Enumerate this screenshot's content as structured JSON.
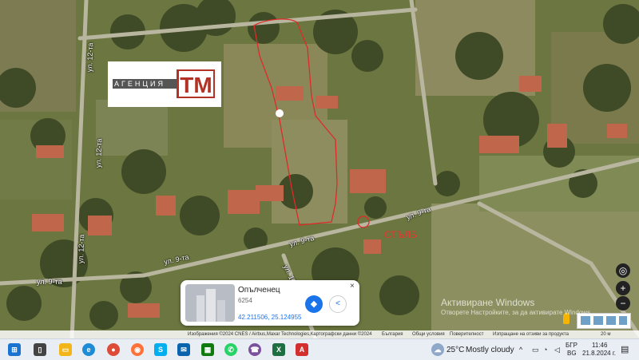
{
  "logo": {
    "agency_text": "АГЕНЦИЯ",
    "mark": "ТМ"
  },
  "map": {
    "roads": [
      {
        "label": "ул. 12-та"
      },
      {
        "label": "ул. 12-та"
      },
      {
        "label": "ул. 12-та"
      },
      {
        "label": "ул. 9-та"
      },
      {
        "label": "ул. 9-та"
      },
      {
        "label": "ул. 9-та"
      },
      {
        "label": "ул. 9-та"
      },
      {
        "label": "ул. 16-та"
      }
    ],
    "annotation": "СТЪЛБ"
  },
  "place_card": {
    "name": "Опълченец",
    "postal": "6254",
    "coordinates": "42.211506, 25.124955",
    "close": "×"
  },
  "watermark": {
    "line1": "Активиране Windows",
    "line2": "Отворете Настройките, за да активирате Windows"
  },
  "attribution": {
    "imagery": "Изображения ©2024 CNES / Airbus,Maxar Technologies,Картографски данни ©2024",
    "country": "България",
    "terms": "Общи условия",
    "privacy": "Поверителност",
    "feedback": "Изпращане на отзиви за продукта",
    "scale": "20 м"
  },
  "taskbar": {
    "weather_temp": "25°C",
    "weather_text": "Mostly cloudy",
    "lang_top": "БГР",
    "lang_bottom": "BG",
    "time": "11:46",
    "date": "21.8.2024 г."
  }
}
